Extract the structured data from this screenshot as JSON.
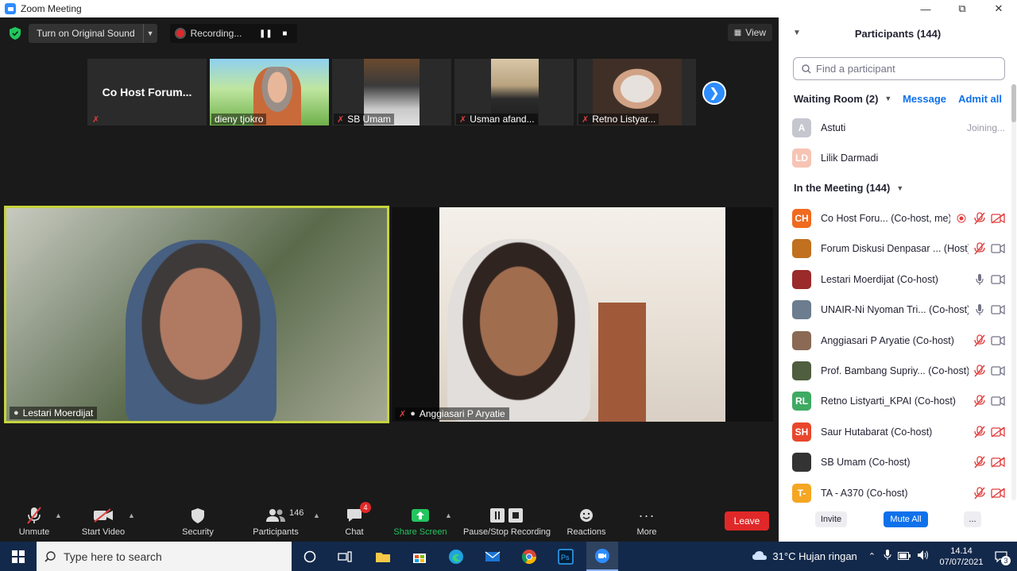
{
  "window": {
    "title": "Zoom Meeting"
  },
  "topbar": {
    "original_sound": "Turn on Original Sound",
    "recording": "Recording...",
    "view": "View"
  },
  "strip": {
    "tiles": [
      {
        "name": "Co Host Forum..."
      },
      {
        "name": "dieny tjokro"
      },
      {
        "name": "SB Umam"
      },
      {
        "name": "Usman afand..."
      },
      {
        "name": "Retno Listyar..."
      }
    ]
  },
  "videos": [
    {
      "name": "Lestari Moerdijat"
    },
    {
      "name": "Anggiasari P Aryatie"
    }
  ],
  "toolbar": {
    "unmute": "Unmute",
    "start_video": "Start Video",
    "security": "Security",
    "participants": "Participants",
    "participants_count": "146",
    "chat": "Chat",
    "chat_badge": "4",
    "share_screen": "Share Screen",
    "recording": "Pause/Stop Recording",
    "reactions": "Reactions",
    "more": "More",
    "leave": "Leave"
  },
  "panel": {
    "title": "Participants (144)",
    "search_placeholder": "Find a participant",
    "waiting_room": "Waiting Room (2)",
    "message": "Message",
    "admit_all": "Admit all",
    "waiting": [
      {
        "initials": "A",
        "name": "Astuti",
        "status": "Joining...",
        "color": "#b9b9c3"
      },
      {
        "initials": "LD",
        "name": "Lilik Darmadi",
        "status": "",
        "color": "#f4b7a5"
      }
    ],
    "in_meeting": "In the Meeting (144)",
    "members": [
      {
        "initials": "CH",
        "name": "Co Host Foru... (Co-host, me)",
        "color": "#f06a1f",
        "mic": "muted",
        "video": "off",
        "rec": true
      },
      {
        "initials": "",
        "name": "Forum Diskusi Denpasar ... (Host)",
        "color": "#c0701e",
        "mic": "muted",
        "video": "on"
      },
      {
        "initials": "",
        "name": "Lestari Moerdijat (Co-host)",
        "color": "#9b2a2a",
        "mic": "on",
        "video": "on"
      },
      {
        "initials": "",
        "name": "UNAIR-Ni Nyoman Tri... (Co-host)",
        "color": "#6b7d8f",
        "mic": "on",
        "video": "on"
      },
      {
        "initials": "",
        "name": "Anggiasari P Aryatie (Co-host)",
        "color": "#8a6a55",
        "mic": "muted",
        "video": "on"
      },
      {
        "initials": "",
        "name": "Prof. Bambang Supriy... (Co-host)",
        "color": "#4e5e3e",
        "mic": "muted",
        "video": "on"
      },
      {
        "initials": "RL",
        "name": "Retno Listyarti_KPAI (Co-host)",
        "color": "#3eaa62",
        "mic": "muted",
        "video": "on"
      },
      {
        "initials": "SH",
        "name": "Saur Hutabarat (Co-host)",
        "color": "#e8472c",
        "mic": "muted",
        "video": "off"
      },
      {
        "initials": "",
        "name": "SB Umam (Co-host)",
        "color": "#333333",
        "mic": "muted",
        "video": "off"
      },
      {
        "initials": "T-",
        "name": "TA - A370 (Co-host)",
        "color": "#f5a623",
        "mic": "muted",
        "video": "off"
      }
    ],
    "invite": "Invite",
    "mute_all": "Mute All",
    "more": "..."
  },
  "taskbar": {
    "search_placeholder": "Type here to search",
    "weather": "31°C  Hujan ringan",
    "time": "14.14",
    "date": "07/07/2021",
    "notifications": "3"
  }
}
